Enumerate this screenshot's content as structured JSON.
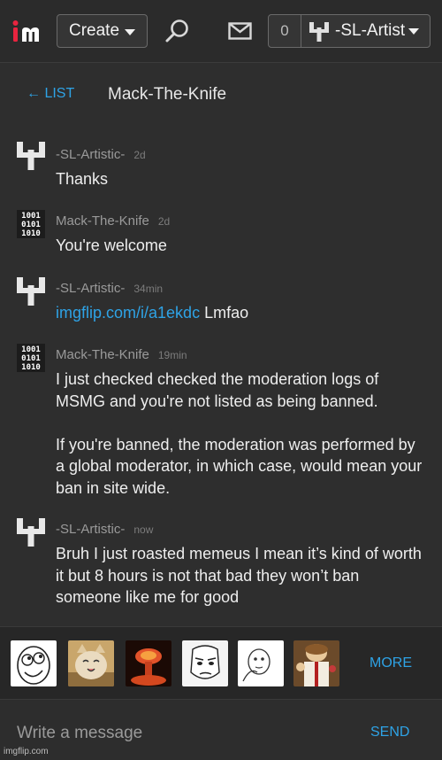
{
  "header": {
    "logo_icon": "imgflip-logo-icon",
    "create_label": "Create",
    "search_icon": "search-icon",
    "mail_icon": "mail-icon",
    "notification_count": "0",
    "username": "-SL-Artistic-",
    "accent_color": "#2ea3e6"
  },
  "conversation": {
    "back_label": "← LIST",
    "title": "Mack-The-Knife"
  },
  "messages": [
    {
      "author": "-SL-Artistic-",
      "time": "2d",
      "text": "Thanks"
    },
    {
      "author": "Mack-The-Knife",
      "time": "2d",
      "text": "You're welcome"
    },
    {
      "author": "-SL-Artistic-",
      "time": "34min",
      "link": "imgflip.com/i/a1ekdc",
      "text": " Lmfao"
    },
    {
      "author": "Mack-The-Knife",
      "time": "19min",
      "paragraphs": [
        "I just checked checked the moderation logs of MSMG and you're not listed as being banned.",
        "If you're banned, the moderation was performed by a global moderator, in which case, would mean your ban in site wide."
      ]
    },
    {
      "author": "-SL-Artistic-",
      "time": "now",
      "text": "Bruh I just roasted memeus I mean it’s kind of worth it but 8 hours is not that bad they won’t ban someone like me for good"
    }
  ],
  "stickers": [
    "derp-face-sticker",
    "happy-cat-sticker",
    "explosion-sticker",
    "okay-guy-sticker",
    "peek-guy-sticker",
    "buddy-christ-sticker"
  ],
  "more_label": "MORE",
  "composer": {
    "placeholder": "Write a message",
    "send_label": "SEND"
  },
  "watermark": "imgflip.com"
}
